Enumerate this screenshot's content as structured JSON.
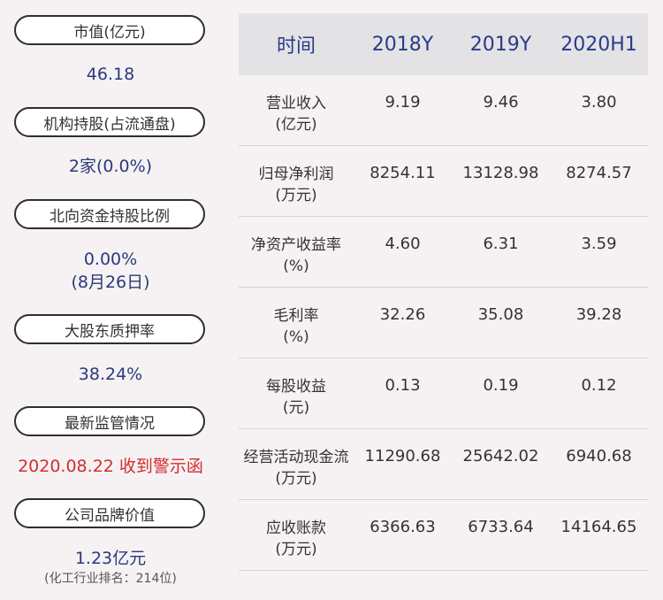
{
  "metrics": [
    {
      "label": "市值(亿元)",
      "value": "46.18"
    },
    {
      "label": "机构持股(占流通盘)",
      "value": "2家(0.0%)"
    },
    {
      "label": "北向资金持股比例",
      "value": "0.00%",
      "value2": "(8月26日)"
    },
    {
      "label": "大股东质押率",
      "value": "38.24%"
    },
    {
      "label": "最新监管情况",
      "value": "2020.08.22 收到警示函"
    },
    {
      "label": "公司品牌价值",
      "value": "1.23亿元",
      "note": "(化工行业排名：214位)"
    }
  ],
  "table": {
    "headers": [
      "时间",
      "2018Y",
      "2019Y",
      "2020H1"
    ],
    "rows": [
      {
        "label1": "营业收入",
        "label2": "(亿元)",
        "values": [
          "9.19",
          "9.46",
          "3.80"
        ]
      },
      {
        "label1": "归母净利润",
        "label2": "(万元)",
        "values": [
          "8254.11",
          "13128.98",
          "8274.57"
        ]
      },
      {
        "label1": "净资产收益率",
        "label2": "(%)",
        "values": [
          "4.60",
          "6.31",
          "3.59"
        ]
      },
      {
        "label1": "毛利率",
        "label2": "(%)",
        "values": [
          "32.26",
          "35.08",
          "39.28"
        ]
      },
      {
        "label1": "每股收益",
        "label2": "(元)",
        "values": [
          "0.13",
          "0.19",
          "0.12"
        ]
      },
      {
        "label1": "经营活动现金流",
        "label2": "(万元)",
        "values": [
          "11290.68",
          "25642.02",
          "6940.68"
        ]
      },
      {
        "label1": "应收账款",
        "label2": "(万元)",
        "values": [
          "6366.63",
          "6733.64",
          "14164.65"
        ]
      }
    ]
  }
}
